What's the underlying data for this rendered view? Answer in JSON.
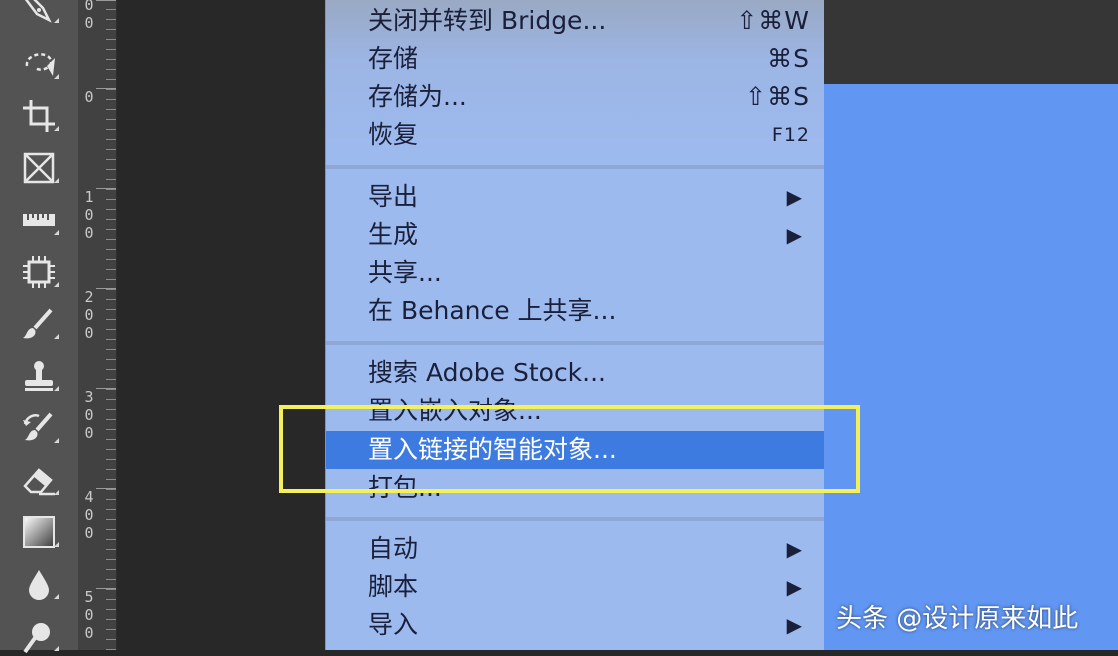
{
  "toolbar": {
    "tools": [
      "pen-tool-icon",
      "lasso-tool-icon",
      "crop-tool-icon",
      "frame-tool-icon",
      "ruler-tool-icon",
      "artboard-tool-icon",
      "brush-tool-icon",
      "stamp-tool-icon",
      "history-brush-tool-icon",
      "eraser-tool-icon",
      "gradient-tool-icon",
      "blur-tool-icon",
      "dodge-tool-icon"
    ]
  },
  "ruler": {
    "labels": [
      "0\n0",
      "0",
      "1\n0\n0",
      "2\n0\n0",
      "3\n0\n0",
      "4\n0\n0",
      "5\n0\n0"
    ]
  },
  "menu": {
    "groups": [
      [
        {
          "label": "关闭并转到 Bridge...",
          "shortcut": "⇧⌘W"
        },
        {
          "label": "存储",
          "shortcut": "⌘S"
        },
        {
          "label": "存储为...",
          "shortcut": "⇧⌘S"
        },
        {
          "label": "恢复",
          "shortcut": "F12"
        }
      ],
      [
        {
          "label": "导出",
          "submenu": true
        },
        {
          "label": "生成",
          "submenu": true
        },
        {
          "label": "共享..."
        },
        {
          "label": "在 Behance 上共享..."
        }
      ],
      [
        {
          "label": "搜索 Adobe Stock..."
        },
        {
          "label": "置入嵌入对象..."
        },
        {
          "label": "置入链接的智能对象...",
          "active": true
        },
        {
          "label": "打包..."
        }
      ],
      [
        {
          "label": "自动",
          "submenu": true
        },
        {
          "label": "脚本",
          "submenu": true
        },
        {
          "label": "导入",
          "submenu": true
        }
      ]
    ],
    "submenu_arrow": "▶"
  },
  "watermark": "头条 @设计原来如此",
  "colors": {
    "menu_bg": "#9dbaef",
    "active": "#3e7be0",
    "highlight": "#f4f05a",
    "canvas": "#6196f2"
  }
}
